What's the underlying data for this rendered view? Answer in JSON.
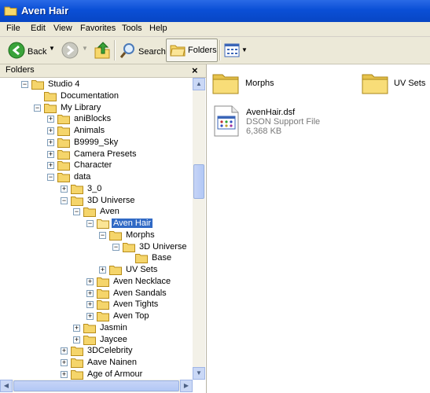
{
  "window": {
    "title": "Aven Hair"
  },
  "menu": [
    "File",
    "Edit",
    "View",
    "Favorites",
    "Tools",
    "Help"
  ],
  "toolbar": {
    "back": "Back",
    "search": "Search",
    "folders": "Folders"
  },
  "folders_pane": {
    "title": "Folders",
    "close": "×"
  },
  "tree": [
    {
      "label": "Studio 4",
      "expander": "−"
    },
    {
      "label": "Documentation",
      "expander": ""
    },
    {
      "label": "My Library",
      "expander": "−"
    },
    {
      "label": "aniBlocks",
      "expander": "+"
    },
    {
      "label": "Animals",
      "expander": "+"
    },
    {
      "label": "B9999_Sky",
      "expander": "+"
    },
    {
      "label": "Camera Presets",
      "expander": "+"
    },
    {
      "label": "Character",
      "expander": "+"
    },
    {
      "label": "data",
      "expander": "−"
    },
    {
      "label": "3_0",
      "expander": "+"
    },
    {
      "label": "3D Universe",
      "expander": "−"
    },
    {
      "label": "Aven",
      "expander": "−"
    },
    {
      "label": "Aven Hair",
      "expander": "−",
      "selected": true
    },
    {
      "label": "Morphs",
      "expander": "−"
    },
    {
      "label": "3D Universe",
      "expander": "−"
    },
    {
      "label": "Base",
      "expander": ""
    },
    {
      "label": "UV Sets",
      "expander": "+"
    },
    {
      "label": "Aven Necklace",
      "expander": "+"
    },
    {
      "label": "Aven Sandals",
      "expander": "+"
    },
    {
      "label": "Aven Tights",
      "expander": "+"
    },
    {
      "label": "Aven Top",
      "expander": "+"
    },
    {
      "label": "Jasmin",
      "expander": "+"
    },
    {
      "label": "Jaycee",
      "expander": "+"
    },
    {
      "label": "3DCelebrity",
      "expander": "+"
    },
    {
      "label": "Aave Nainen",
      "expander": "+"
    },
    {
      "label": "Age of Armour",
      "expander": "+"
    }
  ],
  "content": {
    "folders": [
      "Morphs",
      "UV Sets"
    ],
    "file": {
      "name": "AvenHair.dsf",
      "type": "DSON Support File",
      "size": "6,368 KB"
    }
  },
  "colors": {
    "titlebar": "#0a4fd6",
    "selection": "#316ac5",
    "chrome": "#ece9d8",
    "folder": "#f5d56b"
  }
}
